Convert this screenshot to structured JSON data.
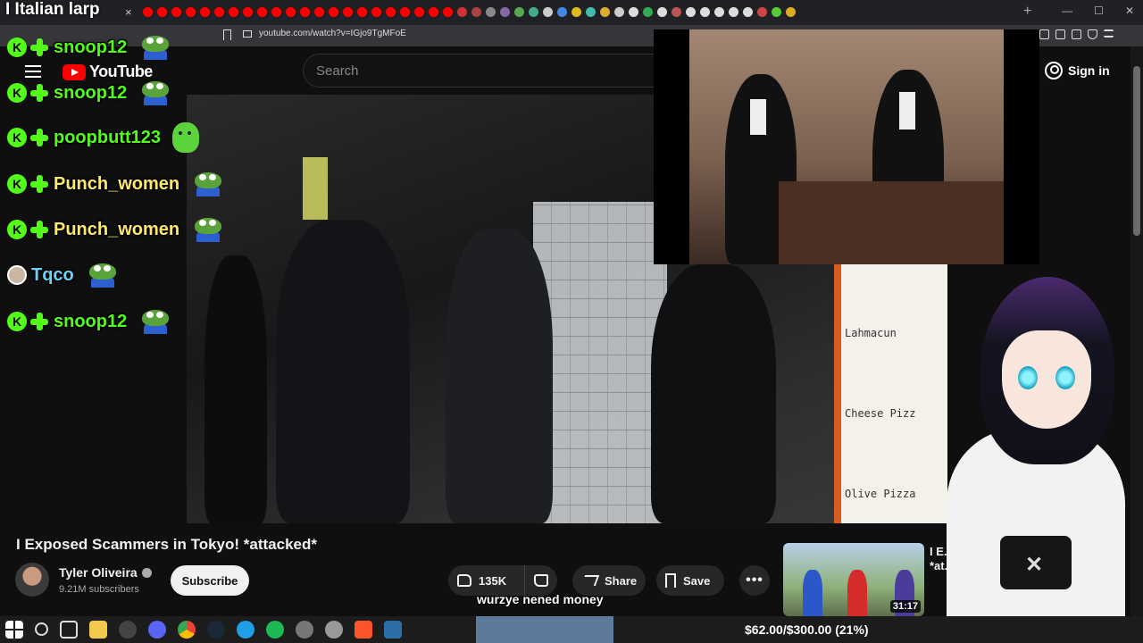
{
  "browser": {
    "tab_title": "I Italian larp",
    "tab_close": "×",
    "new_tab": "+",
    "url": "youtube.com/watch?v=IGjo9TgMFoE",
    "window_controls": [
      "—",
      "☐",
      "✕"
    ]
  },
  "youtube": {
    "logo_text": "YouTube",
    "search_placeholder": "Search",
    "signin_label": "Sign in"
  },
  "chat": {
    "messages": [
      {
        "user": "snoop12",
        "color": "#53fc18",
        "badges": [
          "k-icon",
          "plus-icon"
        ],
        "emote": "pepe"
      },
      {
        "user": "snoop12",
        "color": "#53fc18",
        "badges": [
          "k-icon",
          "plus-icon"
        ],
        "emote": "pepe"
      },
      {
        "user": "poopbutt123",
        "color": "#53fc18",
        "badges": [
          "k-icon",
          "plus-icon"
        ],
        "emote": "blob"
      },
      {
        "user": "Punch_women",
        "color": "#ffe96b",
        "badges": [
          "k-icon",
          "plus-icon"
        ],
        "emote": "pepe"
      },
      {
        "user": "Punch_women",
        "color": "#ffe96b",
        "badges": [
          "k-icon",
          "plus-icon"
        ],
        "emote": "pepe"
      },
      {
        "user": "Tqco",
        "color": "#6fd2f5",
        "badges": [
          "avatar"
        ],
        "emote": "pepe"
      },
      {
        "user": "snoop12",
        "color": "#53fc18",
        "badges": [
          "k-icon",
          "plus-icon"
        ],
        "emote": "pepe"
      }
    ]
  },
  "video": {
    "menu_items": [
      "Lahmacun",
      "Cheese Pizz",
      "Olive Pizza"
    ],
    "title": "I Exposed Scammers in Tokyo! *attacked*",
    "channel_name": "Tyler Oliveira",
    "subscribers": "9.21M subscribers",
    "subscribe_label": "Subscribe",
    "likes": "135K",
    "share_label": "Share",
    "save_label": "Save",
    "more_label": "•••",
    "caption": "wurzye nened money"
  },
  "recommendation": {
    "title": "I E... *at...ked*",
    "duration": "31:17"
  },
  "goal": {
    "text": "$62.00/$300.00 (21%)",
    "current": 62.0,
    "target": 300.0,
    "fraction": 0.21,
    "fill_color": "#5c7a9a"
  },
  "colors": {
    "youtube_red": "#ff0000",
    "kick_green": "#53fc18"
  }
}
